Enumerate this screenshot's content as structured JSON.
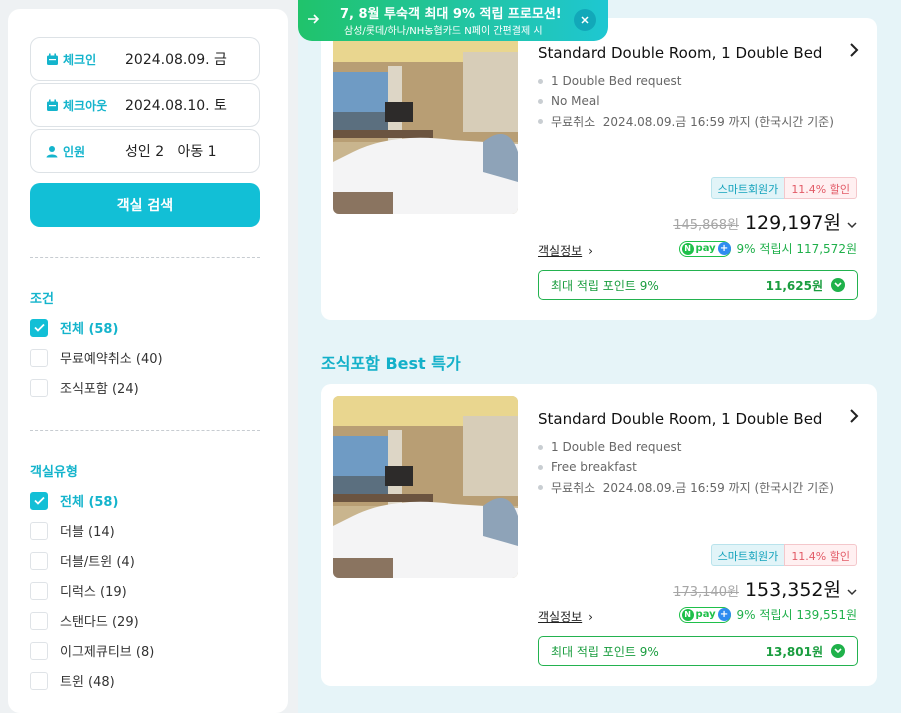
{
  "promo": {
    "title": "7, 8월 투숙객 최대 9% 적립 프로모션!",
    "subtitle": "삼성/롯데/하나/NH농협카드 N페이 간편결제 시"
  },
  "search": {
    "checkin_label": "체크인",
    "checkin_value": "2024.08.09. 금",
    "checkout_label": "체크아웃",
    "checkout_value": "2024.08.10. 토",
    "guests_label": "인원",
    "guests_value": "성인 2   아동 1",
    "button": "객실 검색"
  },
  "filters": {
    "condition_title": "조건",
    "conditions": [
      {
        "label": "전체 (58)",
        "checked": true
      },
      {
        "label": "무료예약취소 (40)",
        "checked": false
      },
      {
        "label": "조식포함 (24)",
        "checked": false
      }
    ],
    "roomtype_title": "객실유형",
    "roomtypes": [
      {
        "label": "전체 (58)",
        "checked": true
      },
      {
        "label": "더블 (14)",
        "checked": false
      },
      {
        "label": "더블/트윈 (4)",
        "checked": false
      },
      {
        "label": "디럭스 (19)",
        "checked": false
      },
      {
        "label": "스탠다드 (29)",
        "checked": false
      },
      {
        "label": "이그제큐티브 (8)",
        "checked": false
      },
      {
        "label": "트윈 (48)",
        "checked": false
      }
    ]
  },
  "section_title": "조식포함 Best 특가",
  "rooms": [
    {
      "name": "Standard Double Room, 1 Double Bed",
      "options": [
        "1 Double Bed request",
        "No Meal",
        "무료취소  2024.08.09.금 16:59 까지 (한국시간 기준)"
      ],
      "member_label": "스마트회원가",
      "discount": "11.4% 할인",
      "orig_price": "145,868원",
      "price": "129,197원",
      "room_info": "객실정보",
      "npay_text": "9% 적립시 117,572원",
      "points_label": "최대 적립 포인트 9%",
      "points_value": "11,625원"
    },
    {
      "name": "Standard Double Room, 1 Double Bed",
      "options": [
        "1 Double Bed request",
        "Free breakfast",
        "무료취소  2024.08.09.금 16:59 까지 (한국시간 기준)"
      ],
      "member_label": "스마트회원가",
      "discount": "11.4% 할인",
      "orig_price": "173,140원",
      "price": "153,352원",
      "room_info": "객실정보",
      "npay_text": "9% 적립시 139,551원",
      "points_label": "최대 적립 포인트 9%",
      "points_value": "13,801원"
    }
  ],
  "colors": {
    "accent": "#12bfd6",
    "green": "#1fb14a",
    "discount": "#e25a66"
  }
}
